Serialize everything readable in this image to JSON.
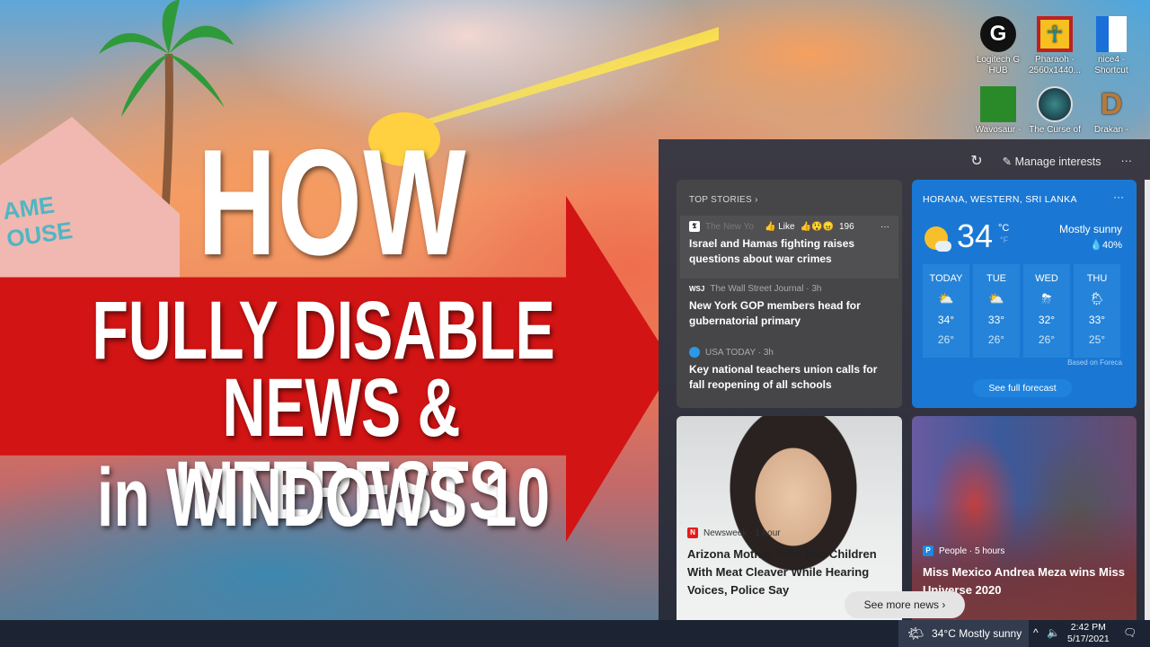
{
  "thumbnail": {
    "line1": "HOW TO",
    "line2": "FULLY DISABLE",
    "line3": "NEWS & INTERESTS",
    "line4": "in WINDOWS 10",
    "arrow_color": "#d21414",
    "house_sign": "AME\nOUSE"
  },
  "desktop_icons": [
    {
      "label": "Logitech G HUB",
      "icon": "logitech-g-icon"
    },
    {
      "label": "Pharaoh - 2560x1440...",
      "icon": "ankh-icon"
    },
    {
      "label": "nice4 - Shortcut",
      "icon": "window-shortcut-icon"
    },
    {
      "label": "Wavosaur -",
      "icon": "monster-icon"
    },
    {
      "label": "The Curse of",
      "icon": "island-globe-icon"
    },
    {
      "label": "Drakan -",
      "icon": "drakan-logo-icon"
    }
  ],
  "panel": {
    "refresh_icon": "refresh-icon",
    "manage_interests": "Manage interests",
    "more": "···",
    "top_stories": {
      "title": "TOP STORIES",
      "items": [
        {
          "source": "The New Yo",
          "like": "Like",
          "reactions": "196",
          "headline": "Israel and Hamas fighting raises questions about war crimes",
          "more": "···"
        },
        {
          "source": "The Wall Street Journal · 3h",
          "logo": "WSJ",
          "headline": "New York GOP members head for gubernatorial primary"
        },
        {
          "source": "USA TODAY · 3h",
          "headline": "Key national teachers union calls for fall reopening of all schools"
        }
      ]
    },
    "weather": {
      "location": "HORANA, WESTERN, SRI LANKA",
      "temp": "34",
      "unit_c": "°C",
      "unit_f": "°F",
      "condition": "Mostly sunny",
      "precip": "40%",
      "more": "···",
      "forecast": [
        {
          "day": "TODAY",
          "high": "34°",
          "low": "26°",
          "icon": "partly-sunny-icon"
        },
        {
          "day": "TUE",
          "high": "33°",
          "low": "26°",
          "icon": "partly-sunny-icon"
        },
        {
          "day": "WED",
          "high": "32°",
          "low": "26°",
          "icon": "thunderstorm-icon"
        },
        {
          "day": "THU",
          "high": "33°",
          "low": "25°",
          "icon": "rain-cloud-icon"
        }
      ],
      "credit": "Based on Foreca",
      "full_forecast": "See full forecast"
    },
    "cards": [
      {
        "source": "Newsweek · 1 hour",
        "logo": "N",
        "headline": "Arizona Mother Kills Two Children With Meat Cleaver While Hearing Voices, Police Say"
      },
      {
        "source": "People · 5 hours",
        "logo": "P",
        "headline": "Miss Mexico Andrea Meza wins Miss Universe 2020"
      }
    ],
    "see_more": "See more news"
  },
  "taskbar": {
    "weather": "34°C  Mostly sunny",
    "time": "2:42 PM",
    "date": "5/17/2021"
  }
}
